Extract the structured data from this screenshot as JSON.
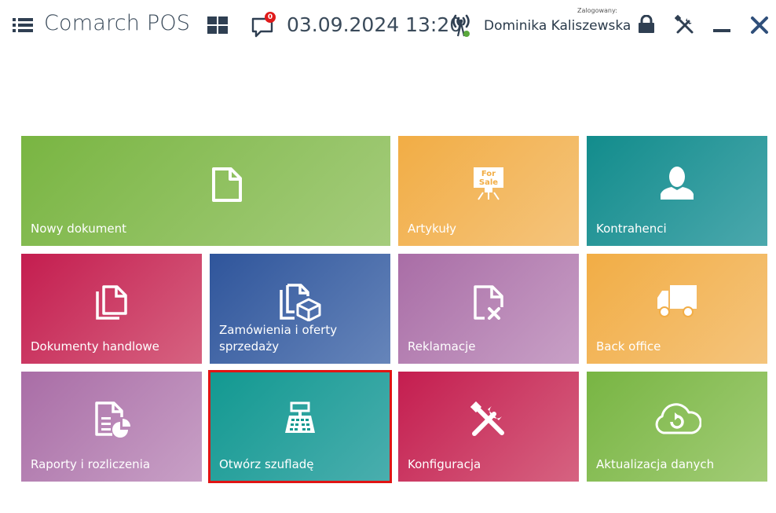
{
  "header": {
    "app_title": "Comarch POS",
    "notifications_count": "0",
    "datetime": "03.09.2024 13:20",
    "logged_label": "Zalogowany:",
    "user_name": "Dominika Kaliszewska"
  },
  "tiles": [
    {
      "label": "Nowy dokument",
      "icon": "new-document-icon",
      "color": "#79b542"
    },
    {
      "label": "Artykuły",
      "icon": "for-sale-sign-icon",
      "icon_text": [
        "For",
        "Sale"
      ],
      "color": "#f2ad45"
    },
    {
      "label": "Kontrahenci",
      "icon": "person-icon",
      "color": "#128c8c"
    },
    {
      "label": "Dokumenty handlowe",
      "icon": "documents-icon",
      "color": "#c41d4f"
    },
    {
      "label": "Zamówienia i oferty sprzedaży",
      "icon": "documents-box-icon",
      "color": "#2f559b"
    },
    {
      "label": "Reklamacje",
      "icon": "document-x-icon",
      "color": "#a96da6"
    },
    {
      "label": "Back office",
      "icon": "truck-icon",
      "color": "#f2ad45"
    },
    {
      "label": "Raporty i rozliczenia",
      "icon": "report-chart-icon",
      "color": "#a96da6"
    },
    {
      "label": "Otwórz szufladę",
      "icon": "cash-register-icon",
      "color": "#129991",
      "selected": true
    },
    {
      "label": "Konfiguracja",
      "icon": "tools-icon",
      "color": "#c41d4f"
    },
    {
      "label": "Aktualizacja danych",
      "icon": "cloud-refresh-icon",
      "color": "#78b543"
    }
  ],
  "colors": {
    "selection": "#e01414",
    "badge": "#e01a1a",
    "status_online": "#5aa83c"
  }
}
